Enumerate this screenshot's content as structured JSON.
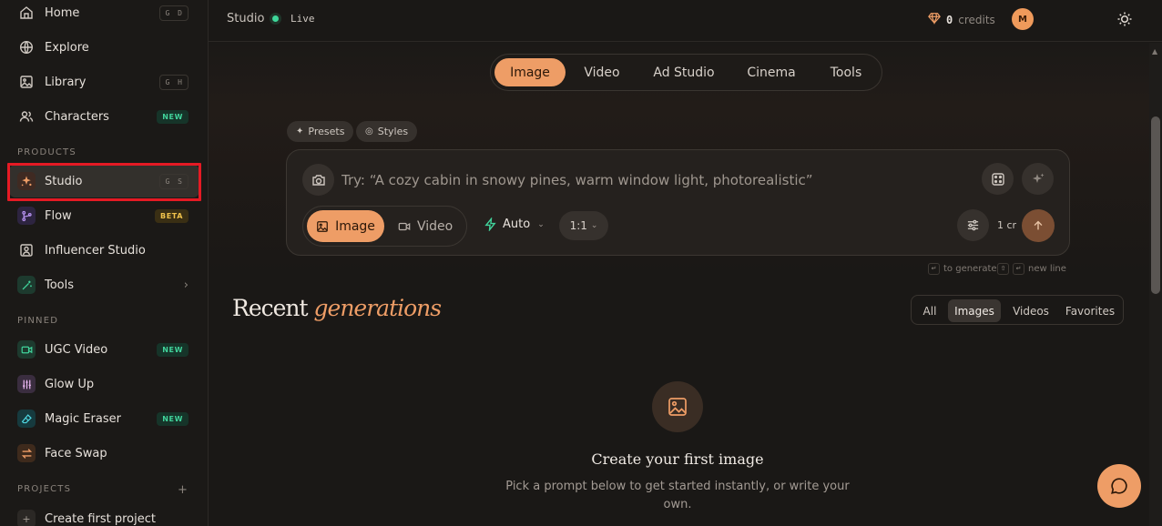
{
  "sidebar": {
    "items": [
      {
        "label": "Home",
        "shortcut": "G D",
        "icon": "home-icon"
      },
      {
        "label": "Explore",
        "icon": "globe-icon"
      },
      {
        "label": "Library",
        "shortcut": "G H",
        "icon": "image-icon"
      },
      {
        "label": "Characters",
        "badge": "NEW",
        "icon": "users-icon"
      }
    ],
    "products_title": "PRODUCTS",
    "products": [
      {
        "label": "Studio",
        "shortcut": "G S",
        "icon": "sparkle-icon",
        "active": true
      },
      {
        "label": "Flow",
        "badge": "BETA",
        "icon": "flow-icon"
      },
      {
        "label": "Influencer Studio",
        "icon": "portrait-icon"
      },
      {
        "label": "Tools",
        "icon": "wand-icon"
      }
    ],
    "pinned_title": "PINNED",
    "pinned": [
      {
        "label": "UGC Video",
        "badge": "NEW",
        "icon": "video-camera-icon"
      },
      {
        "label": "Glow Up",
        "icon": "sliders-icon"
      },
      {
        "label": "Magic Eraser",
        "badge": "NEW",
        "icon": "eraser-icon"
      },
      {
        "label": "Face Swap",
        "icon": "swap-icon"
      }
    ],
    "projects_title": "PROJECTS",
    "projects_add": "+",
    "create_project": {
      "label": "Create first project",
      "icon_text": "+"
    }
  },
  "topbar": {
    "title": "Studio",
    "live": "Live",
    "credits_count": "0",
    "credits_label": "credits",
    "avatar_initial": "M"
  },
  "mode_tabs": [
    "Image",
    "Video",
    "Ad Studio",
    "Cinema",
    "Tools"
  ],
  "chips": {
    "presets": "Presets",
    "styles": "Styles"
  },
  "prompt": {
    "placeholder": "Try: “A cozy cabin in snowy pines, warm window light, photorealistic”",
    "type_image": "Image",
    "type_video": "Video",
    "model": "Auto",
    "ratio": "1:1",
    "cost": "1 cr"
  },
  "hints": {
    "generate": "to generate",
    "newline": "new line"
  },
  "recent": {
    "title_plain": "Recent",
    "title_italic": "generations",
    "filters": [
      "All",
      "Images",
      "Videos",
      "Favorites"
    ],
    "active_filter": "Images"
  },
  "empty": {
    "title": "Create your first image",
    "subtitle": "Pick a prompt below to get started instantly, or write your own."
  },
  "colors": {
    "accent": "#ee9d66",
    "live": "#3ed79a",
    "highlight": "#e51a24"
  }
}
